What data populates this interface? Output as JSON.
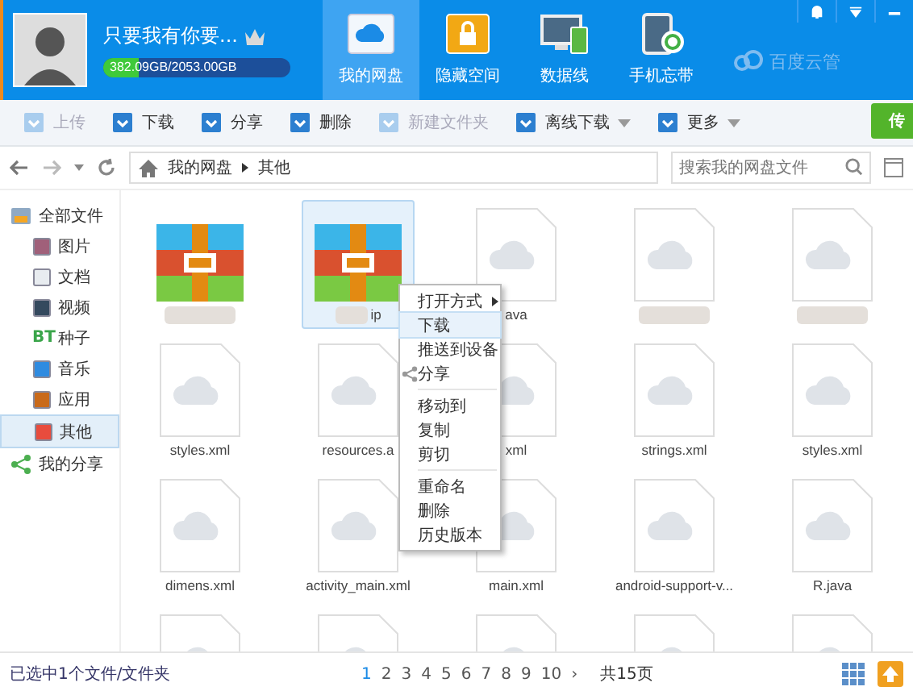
{
  "user": {
    "name": "只要我有你要...",
    "storage": {
      "text": "382.09GB/2053.00GB",
      "level": 0.186
    }
  },
  "nav_tabs": [
    {
      "label": "我的网盘",
      "selected": true
    },
    {
      "label": "隐藏空间",
      "selected": false
    },
    {
      "label": "数据线",
      "selected": false
    },
    {
      "label": "手机忘带",
      "selected": false
    }
  ],
  "brand": "百度云管",
  "toolbar": [
    {
      "label": "上传",
      "disabled": true,
      "dropdown": false
    },
    {
      "label": "下载",
      "disabled": false,
      "dropdown": false
    },
    {
      "label": "分享",
      "disabled": false,
      "dropdown": false
    },
    {
      "label": "删除",
      "disabled": false,
      "dropdown": false
    },
    {
      "label": "新建文件夹",
      "disabled": true,
      "dropdown": false
    },
    {
      "label": "离线下载",
      "disabled": false,
      "dropdown": true
    },
    {
      "label": "更多",
      "disabled": false,
      "dropdown": true
    }
  ],
  "transfer_button": "传",
  "breadcrumb": [
    "我的网盘",
    "其他"
  ],
  "search": {
    "placeholder": "搜索我的网盘文件"
  },
  "sidebar": {
    "items": [
      {
        "label": "全部文件",
        "selected": false,
        "children": [
          {
            "label": "图片",
            "selected": false
          },
          {
            "label": "文档",
            "selected": false
          },
          {
            "label": "视频",
            "selected": false
          },
          {
            "label": "种子",
            "selected": false,
            "icon_text": "BT"
          },
          {
            "label": "音乐",
            "selected": false
          },
          {
            "label": "应用",
            "selected": false
          },
          {
            "label": "其他",
            "selected": true
          }
        ]
      },
      {
        "label": "我的分享",
        "selected": false
      }
    ]
  },
  "files": [
    {
      "kind": "zip",
      "blurred": true,
      "selected": false
    },
    {
      "kind": "zip",
      "name": "ip",
      "blurred": true,
      "selected": true
    },
    {
      "kind": "doc",
      "name": "ava",
      "blurred": false,
      "selected": false
    },
    {
      "kind": "doc",
      "blurred": true,
      "selected": false
    },
    {
      "kind": "doc",
      "blurred": true,
      "selected": false
    },
    {
      "kind": "doc",
      "name": "styles.xml",
      "blurred": false,
      "selected": false
    },
    {
      "kind": "doc",
      "name": "resources.a",
      "blurred": false,
      "selected": false
    },
    {
      "kind": "doc",
      "name": "xml",
      "blurred": false,
      "selected": false
    },
    {
      "kind": "doc",
      "name": "strings.xml",
      "blurred": false,
      "selected": false
    },
    {
      "kind": "doc",
      "name": "styles.xml",
      "blurred": false,
      "selected": false
    },
    {
      "kind": "doc",
      "name": "dimens.xml",
      "blurred": false,
      "selected": false
    },
    {
      "kind": "doc",
      "name": "activity_main.xml",
      "blurred": false,
      "selected": false
    },
    {
      "kind": "doc",
      "name": "main.xml",
      "blurred": false,
      "selected": false
    },
    {
      "kind": "doc",
      "name": "android-support-v...",
      "blurred": false,
      "selected": false
    },
    {
      "kind": "doc",
      "name": "R.java",
      "blurred": false,
      "selected": false
    },
    {
      "kind": "doc",
      "blurred": false,
      "selected": false
    },
    {
      "kind": "doc",
      "blurred": false,
      "selected": false
    },
    {
      "kind": "doc",
      "blurred": false,
      "selected": false
    },
    {
      "kind": "doc",
      "blurred": false,
      "selected": false
    },
    {
      "kind": "doc",
      "blurred": false,
      "selected": false
    }
  ],
  "context_menu": {
    "groups": [
      [
        {
          "label": "打开方式",
          "submenu": true,
          "selected": false
        },
        {
          "label": "下载",
          "submenu": false,
          "selected": true
        },
        {
          "label": "推送到设备",
          "submenu": false,
          "selected": false
        },
        {
          "label": "分享",
          "submenu": false,
          "selected": false,
          "share_icon": true
        }
      ],
      [
        {
          "label": "移动到",
          "submenu": false,
          "selected": false
        },
        {
          "label": "复制",
          "submenu": false,
          "selected": false
        },
        {
          "label": "剪切",
          "submenu": false,
          "selected": false
        }
      ],
      [
        {
          "label": "重命名",
          "submenu": false,
          "selected": false
        },
        {
          "label": "删除",
          "submenu": false,
          "selected": false
        },
        {
          "label": "历史版本",
          "submenu": false,
          "selected": false
        }
      ]
    ]
  },
  "status_bar": {
    "selection": "已选中1个文件/文件夹",
    "pages": [
      {
        "label": "1",
        "selected": true
      },
      {
        "label": "2",
        "selected": false
      },
      {
        "label": "3",
        "selected": false
      },
      {
        "label": "4",
        "selected": false
      },
      {
        "label": "5",
        "selected": false
      },
      {
        "label": "6",
        "selected": false
      },
      {
        "label": "7",
        "selected": false
      },
      {
        "label": "8",
        "selected": false
      },
      {
        "label": "9",
        "selected": false
      },
      {
        "label": "10",
        "selected": false
      }
    ],
    "next": "›",
    "total": "共15页"
  }
}
